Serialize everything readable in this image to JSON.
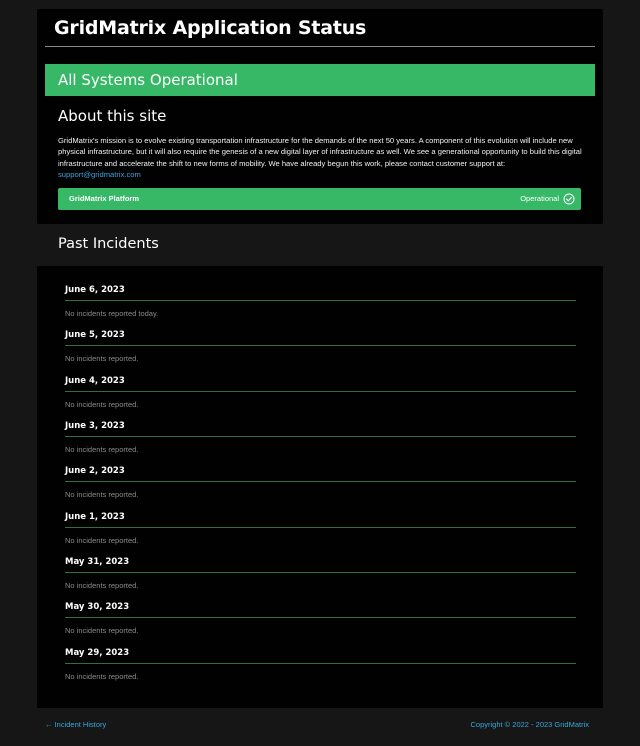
{
  "header": {
    "title": "GridMatrix Application Status"
  },
  "status_banner": {
    "text": "All Systems Operational",
    "color": "#37b867"
  },
  "about": {
    "heading": "About this site",
    "text": "GridMatrix's mission is to evolve existing transportation infrastructure for the demands of the next 50 years. A component of this evolution will include new physical infrastructure, but it will also require the genesis of a new digital layer of infrastructure as well. We see a generational opportunity to build this digital infrastructure and accelerate the shift to new forms of mobility. We have already begun this work, please contact customer support at:",
    "support_email": "support@gridmatrix.com"
  },
  "components": [
    {
      "name": "GridMatrix Platform",
      "status": "Operational",
      "icon": "check-circle-icon"
    }
  ],
  "past_incidents": {
    "heading": "Past Incidents",
    "days": [
      {
        "date": "June 6, 2023",
        "note": "No incidents reported today."
      },
      {
        "date": "June 5, 2023",
        "note": "No incidents reported."
      },
      {
        "date": "June 4, 2023",
        "note": "No incidents reported."
      },
      {
        "date": "June 3, 2023",
        "note": "No incidents reported."
      },
      {
        "date": "June 2, 2023",
        "note": "No incidents reported."
      },
      {
        "date": "June 1, 2023",
        "note": "No incidents reported."
      },
      {
        "date": "May 31, 2023",
        "note": "No incidents reported."
      },
      {
        "date": "May 30, 2023",
        "note": "No incidents reported."
      },
      {
        "date": "May 29, 2023",
        "note": "No incidents reported."
      }
    ]
  },
  "footer": {
    "history_link": "← Incident History",
    "copyright": "Copyright © 2022 - 2023 GridMatrix"
  },
  "colors": {
    "accent": "#37b867",
    "link": "#3aa7d8",
    "background": "#161616",
    "panel": "#010101"
  }
}
